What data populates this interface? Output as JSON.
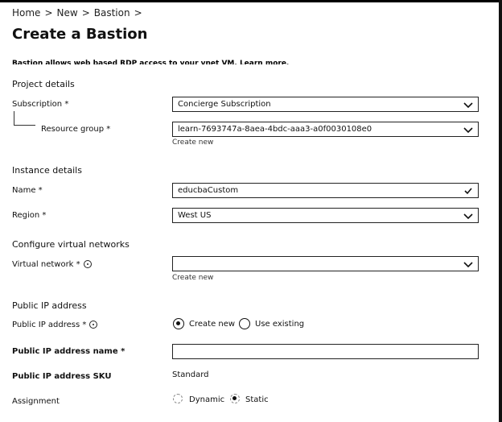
{
  "breadcrumb": [
    "Home",
    "New",
    "Bastion"
  ],
  "page_title": "Create a Bastion",
  "intro_text": "Bastion allows web based RDP access to your vnet VM. Learn more.",
  "project_details": {
    "heading": "Project details",
    "subscription_label": "Subscription *",
    "subscription_value": "Concierge Subscription",
    "resource_group_label": "Resource group *",
    "resource_group_value": "learn-7693747a-8aea-4bdc-aaa3-a0f0030108e0",
    "create_new": "Create new"
  },
  "instance_details": {
    "heading": "Instance details",
    "name_label": "Name *",
    "name_value": "educbaCustom",
    "region_label": "Region *",
    "region_value": "West US"
  },
  "virtual_networks": {
    "heading": "Configure virtual networks",
    "vnet_label": "Virtual network *",
    "vnet_value": "",
    "create_new": "Create new"
  },
  "public_ip": {
    "heading": "Public IP address",
    "ip_label": "Public IP address *",
    "option_create_new": "Create new",
    "option_use_existing": "Use existing",
    "selected_option": "Create new",
    "name_label": "Public IP address name *",
    "name_value": "",
    "sku_label": "Public IP address SKU",
    "sku_value": "Standard",
    "assignment_label": "Assignment",
    "assignment_dynamic": "Dynamic",
    "assignment_static": "Static",
    "assignment_selected": "Static"
  },
  "colors": {
    "text": "#111111",
    "border": "#222222",
    "background": "#ffffff"
  }
}
